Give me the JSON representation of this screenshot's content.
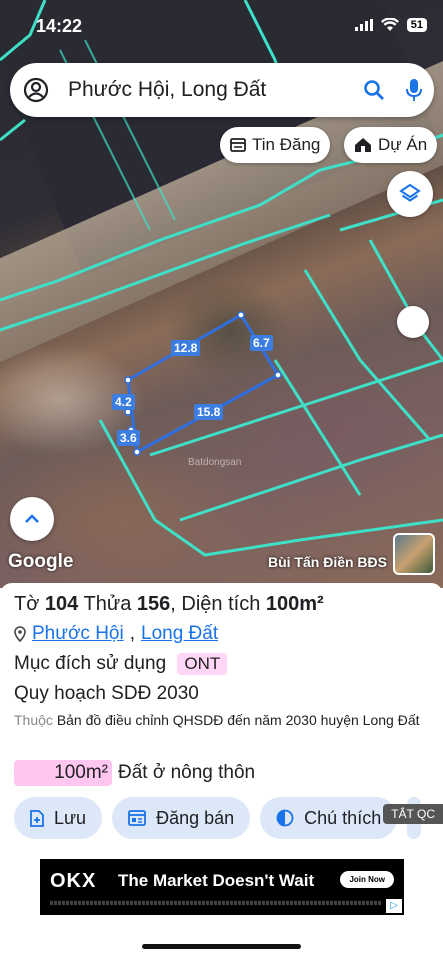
{
  "status_bar": {
    "time": "14:22",
    "battery": "51"
  },
  "search": {
    "query": "Phước Hội, Long Đất"
  },
  "chips": {
    "tin_dang": "Tin Đăng",
    "du_an": "Dự Án"
  },
  "map": {
    "dimensions": [
      "12.8",
      "6.7",
      "4.2",
      "15.8",
      "3.6"
    ],
    "watermark": "Batdongsan",
    "attribution": "Google",
    "owner_name": "Bùi Tấn Điền BĐS"
  },
  "parcel": {
    "to_label": "Tờ",
    "to_value": "104",
    "thua_label": "Thửa",
    "thua_value": "156",
    "dien_tich_label": ", Diện tích",
    "dien_tich_value": "100m²",
    "ward": "Phước Hội",
    "district": "Long Đất",
    "muc_dich_label": "Mục đích sử dụng",
    "muc_dich_code": "ONT",
    "quy_hoach": "Quy hoạch SDĐ 2030",
    "thuoc_prefix": "Thuộc",
    "thuoc_text": "Bản đồ điều chỉnh QHSDĐ đến năm 2030 huyện Long Đất",
    "area_value": "100m²",
    "area_type": "Đất ở nông thôn"
  },
  "actions": {
    "luu": "Lưu",
    "dang_ban": "Đăng bán",
    "chu_thich": "Chú thích"
  },
  "tat_qc": "TẮT QC",
  "ad": {
    "logo": "OKX",
    "headline": "The Market Doesn't Wait",
    "cta": "Join Now"
  },
  "colors": {
    "accent": "#1a73e8",
    "parcel_line": "#3fe0c8",
    "badge_pink": "#ffc6f0"
  }
}
